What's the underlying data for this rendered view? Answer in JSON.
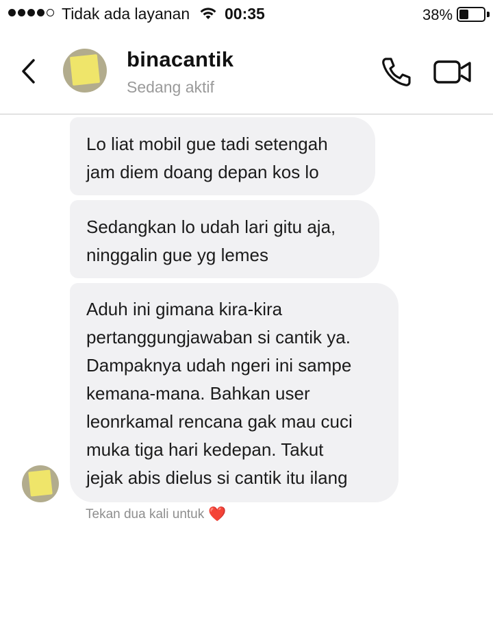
{
  "status_bar": {
    "carrier": "Tidak ada layanan",
    "time": "00:35",
    "battery_percent": "38%",
    "battery_level": 0.38,
    "signal_bars_filled": 4,
    "signal_bars_total": 5
  },
  "header": {
    "back_icon": "chevron-left-icon",
    "contact_name": "binacantik",
    "contact_status": "Sedang aktif",
    "call_icon": "phone-icon",
    "video_icon": "video-camera-icon"
  },
  "messages": [
    {
      "sender": "them",
      "lines": [
        "Lo liat mobil gue tadi setengah",
        "jam diem doang depan kos lo"
      ]
    },
    {
      "sender": "them",
      "lines": [
        "Sedangkan lo udah lari gitu aja,",
        "ninggalin gue yg lemes"
      ]
    },
    {
      "sender": "them",
      "lines": [
        "Aduh ini gimana kira-kira",
        "pertanggungjawaban si cantik ya.",
        "Dampaknya udah ngeri ini sampe",
        "kemana-mana. Bahkan user",
        "leonrkamal rencana gak mau cuci",
        "muka tiga hari kedepan. Takut",
        "jejak abis dielus si cantik itu ilang"
      ]
    }
  ],
  "hint": {
    "text": "Tekan dua kali untuk",
    "icon": "heart-icon",
    "emoji": "❤️"
  },
  "colors": {
    "bubble_bg": "#f1f1f3",
    "heart": "#e0203a",
    "muted_text": "#9a9a9a"
  }
}
